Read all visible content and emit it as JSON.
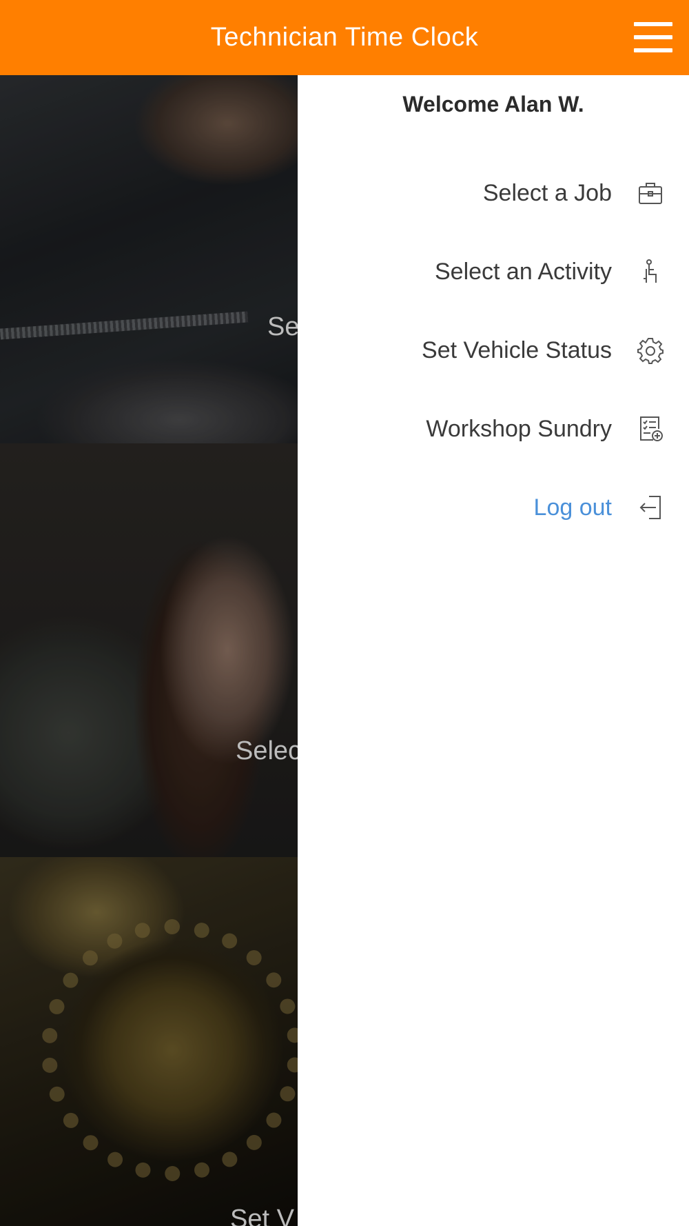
{
  "header": {
    "title": "Technician Time Clock",
    "menu_icon": "hamburger-menu-icon",
    "background_color": "#ff7f00"
  },
  "background_tiles": [
    {
      "label": "Se"
    },
    {
      "label": "Selec"
    },
    {
      "label": "Set V"
    }
  ],
  "drawer": {
    "welcome": "Welcome Alan W.",
    "items": [
      {
        "label": "Select a Job",
        "icon": "briefcase-icon"
      },
      {
        "label": "Select an Activity",
        "icon": "seated-person-icon"
      },
      {
        "label": "Set Vehicle Status",
        "icon": "gear-icon"
      },
      {
        "label": "Workshop Sundry",
        "icon": "checklist-add-icon"
      },
      {
        "label": "Log out",
        "icon": "logout-icon",
        "color": "#4a90d9"
      }
    ]
  }
}
